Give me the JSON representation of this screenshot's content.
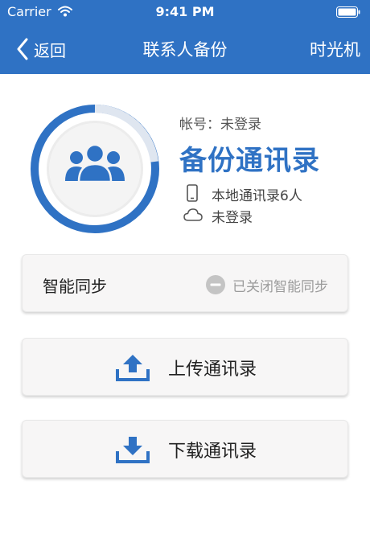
{
  "status_bar": {
    "carrier": "Carrier",
    "time": "9:41 PM"
  },
  "nav": {
    "back_label": "返回",
    "title": "联系人备份",
    "right_label": "时光机"
  },
  "profile": {
    "account_line": "帐号：未登录",
    "title": "备份通讯录",
    "local_count": "本地通讯录6人",
    "cloud_status": "未登录"
  },
  "smart_sync": {
    "label": "智能同步",
    "status": "已关闭智能同步"
  },
  "actions": {
    "upload_label": "上传通讯录",
    "download_label": "下载通讯录"
  },
  "colors": {
    "brand": "#2f72c4",
    "card_bg": "#f7f6f6",
    "muted": "#9b9b9b"
  }
}
